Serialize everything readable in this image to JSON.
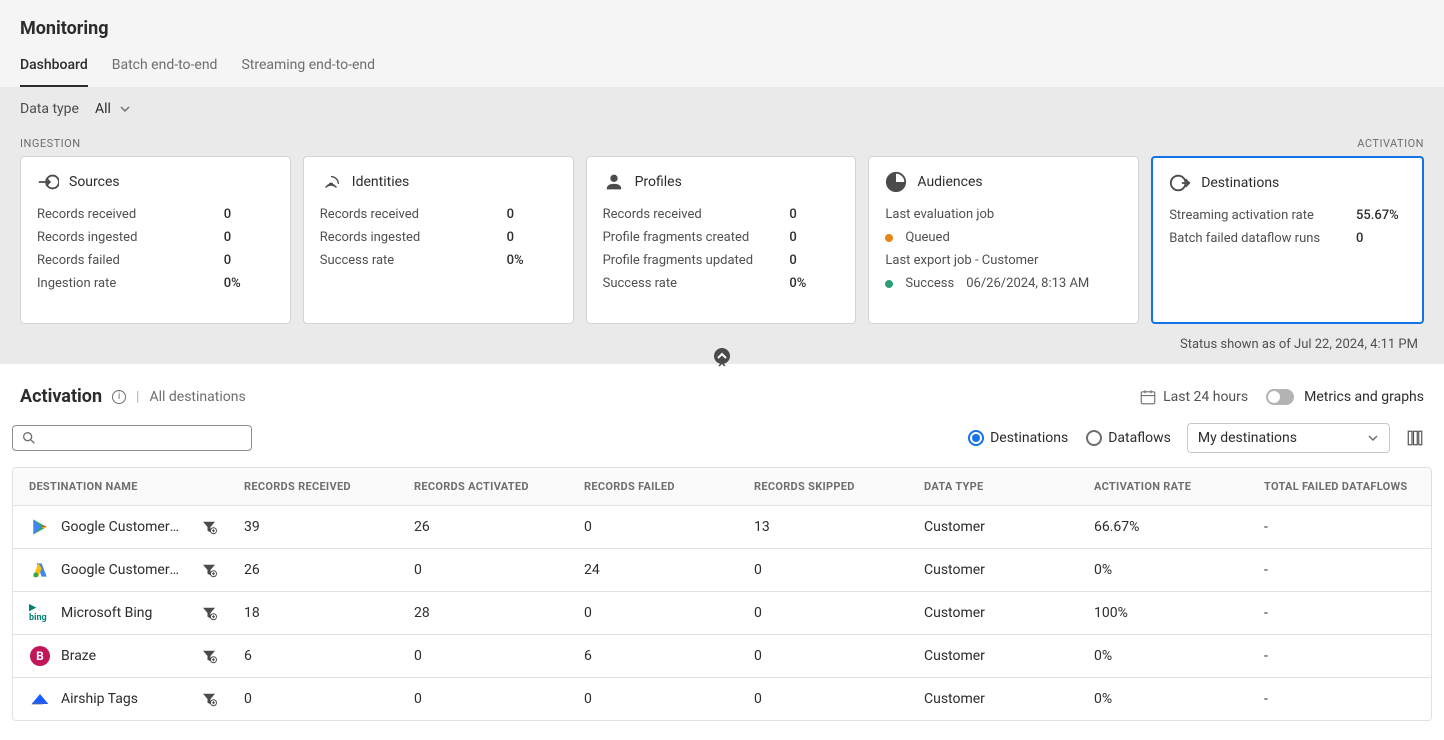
{
  "header": {
    "title": "Monitoring"
  },
  "tabs": [
    {
      "label": "Dashboard",
      "active": true
    },
    {
      "label": "Batch end-to-end",
      "active": false
    },
    {
      "label": "Streaming end-to-end",
      "active": false
    }
  ],
  "filters": {
    "data_type_label": "Data type",
    "data_type_value": "All"
  },
  "section_labels": {
    "ingestion": "INGESTION",
    "activation": "ACTIVATION"
  },
  "cards": {
    "sources": {
      "title": "Sources",
      "rows": [
        {
          "label": "Records received",
          "value": "0"
        },
        {
          "label": "Records ingested",
          "value": "0"
        },
        {
          "label": "Records failed",
          "value": "0"
        },
        {
          "label": "Ingestion rate",
          "value": "0%"
        }
      ]
    },
    "identities": {
      "title": "Identities",
      "rows": [
        {
          "label": "Records received",
          "value": "0"
        },
        {
          "label": "Records ingested",
          "value": "0"
        },
        {
          "label": "Success rate",
          "value": "0%"
        }
      ]
    },
    "profiles": {
      "title": "Profiles",
      "rows": [
        {
          "label": "Records received",
          "value": "0"
        },
        {
          "label": "Profile fragments created",
          "value": "0"
        },
        {
          "label": "Profile fragments updated",
          "value": "0"
        },
        {
          "label": "Success rate",
          "value": "0%"
        }
      ]
    },
    "audiences": {
      "title": "Audiences",
      "last_eval_label": "Last evaluation job",
      "eval_status": "Queued",
      "last_export_label": "Last export job - Customer",
      "export_status": "Success",
      "export_time": "06/26/2024, 8:13 AM"
    },
    "destinations": {
      "title": "Destinations",
      "rows": [
        {
          "label": "Streaming activation rate",
          "value": "55.67%"
        },
        {
          "label": "Batch failed dataflow runs",
          "value": "0"
        }
      ]
    }
  },
  "status_text": "Status shown as of Jul 22, 2024, 4:11 PM",
  "activation": {
    "title": "Activation",
    "subtitle": "All destinations",
    "time_range": "Last 24 hours",
    "metrics_toggle_label": "Metrics and graphs"
  },
  "toolbar": {
    "search_placeholder": "",
    "radio_destinations": "Destinations",
    "radio_dataflows": "Dataflows",
    "scope_select": "My destinations"
  },
  "table": {
    "columns": [
      "DESTINATION NAME",
      "RECORDS RECEIVED",
      "RECORDS ACTIVATED",
      "RECORDS FAILED",
      "RECORDS SKIPPED",
      "DATA TYPE",
      "ACTIVATION RATE",
      "TOTAL FAILED DATAFLOWS"
    ],
    "rows": [
      {
        "icon": "google-play",
        "name": "Google Customer M",
        "received": "39",
        "activated": "26",
        "failed": "0",
        "skipped": "13",
        "data_type": "Customer",
        "rate": "66.67%",
        "failed_dataflows": "-"
      },
      {
        "icon": "google-ads",
        "name": "Google Customer M",
        "received": "26",
        "activated": "0",
        "failed": "24",
        "skipped": "0",
        "data_type": "Customer",
        "rate": "0%",
        "failed_dataflows": "-"
      },
      {
        "icon": "bing",
        "name": "Microsoft Bing",
        "received": "18",
        "activated": "28",
        "failed": "0",
        "skipped": "0",
        "data_type": "Customer",
        "rate": "100%",
        "failed_dataflows": "-"
      },
      {
        "icon": "braze",
        "name": "Braze",
        "received": "6",
        "activated": "0",
        "failed": "6",
        "skipped": "0",
        "data_type": "Customer",
        "rate": "0%",
        "failed_dataflows": "-"
      },
      {
        "icon": "airship",
        "name": "Airship Tags",
        "received": "0",
        "activated": "0",
        "failed": "0",
        "skipped": "0",
        "data_type": "Customer",
        "rate": "0%",
        "failed_dataflows": "-"
      }
    ]
  }
}
